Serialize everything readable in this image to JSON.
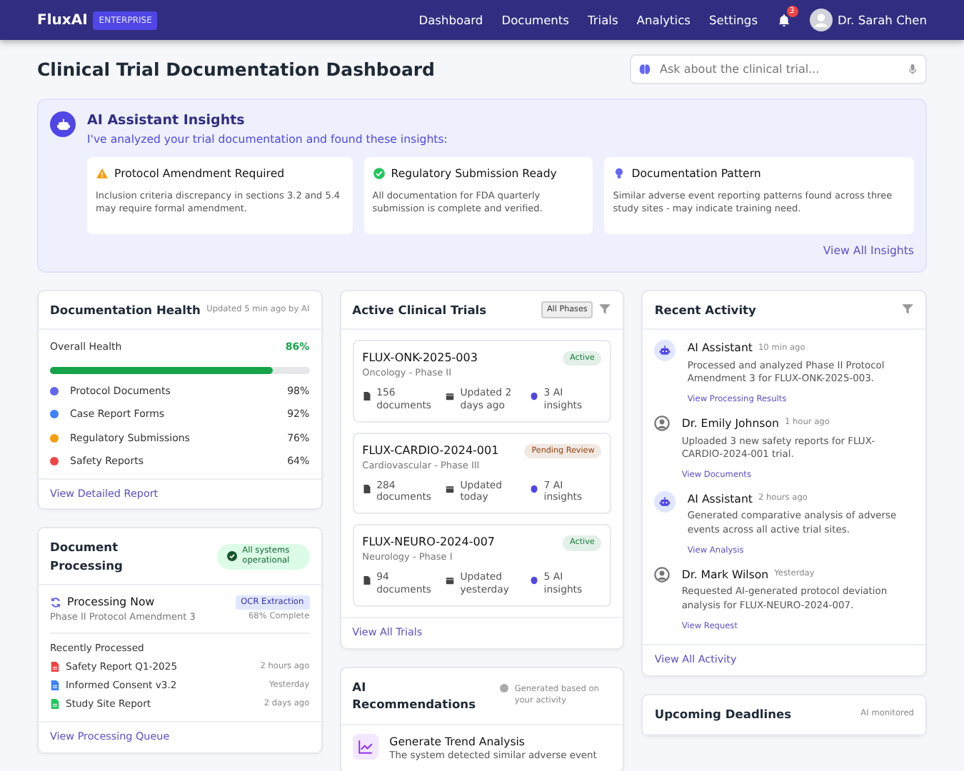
{
  "navbar": {
    "brand": "FluxAI",
    "edition": "ENTERPRISE",
    "links": [
      "Dashboard",
      "Documents",
      "Trials",
      "Analytics",
      "Settings"
    ],
    "notifications": "3",
    "user": "Dr. Sarah Chen"
  },
  "page_title": "Clinical Trial Documentation Dashboard",
  "search": {
    "placeholder": "Ask about the clinical trial..."
  },
  "insights": {
    "title": "AI Assistant Insights",
    "subtitle": "I've analyzed your trial documentation and found these insights:",
    "cards": [
      {
        "kind": "warning",
        "title": "Protocol Amendment Required",
        "text": "Inclusion criteria discrepancy in sections 3.2 and 5.4 may require formal amendment."
      },
      {
        "kind": "success",
        "title": "Regulatory Submission Ready",
        "text": "All documentation for FDA quarterly submission is complete and verified."
      },
      {
        "kind": "idea",
        "title": "Documentation Pattern",
        "text": "Similar adverse event reporting patterns found across three study sites - may indicate training need."
      }
    ],
    "link": "View All Insights"
  },
  "health": {
    "title": "Documentation Health",
    "updated": "Updated 5 min ago by AI",
    "overall_label": "Overall Health",
    "overall_value": "86%",
    "level": 0.86,
    "items": [
      {
        "label": "Protocol Documents",
        "value": "98%",
        "color": "#6366f1"
      },
      {
        "label": "Case Report Forms",
        "value": "92%",
        "color": "#3b82f6"
      },
      {
        "label": "Regulatory Submissions",
        "value": "76%",
        "color": "#f59e0b"
      },
      {
        "label": "Safety Reports",
        "value": "64%",
        "color": "#ef4444"
      }
    ],
    "link": "View Detailed Report"
  },
  "processing": {
    "title": "Document Processing",
    "status": "All systems operational",
    "now_title": "Processing Now",
    "now_document": "Phase II Protocol Amendment 3",
    "now_tag": "OCR Extraction",
    "now_progress": "68% Complete",
    "recent_label": "Recently Processed",
    "items": [
      {
        "kind": "pdf",
        "name": "Safety Report Q1-2025",
        "time": "2 hours ago"
      },
      {
        "kind": "doc",
        "name": "Informed Consent v3.2",
        "time": "Yesterday"
      },
      {
        "kind": "sheet",
        "name": "Study Site Report",
        "time": "2 days ago"
      }
    ],
    "link": "View Processing Queue"
  },
  "trials": {
    "title": "Active Clinical Trials",
    "filter": "All Phases",
    "items": [
      {
        "id": "FLUX-ONK-2025-003",
        "area": "Oncology - Phase II",
        "status": "Active",
        "color": "#15803d",
        "documents": "156 documents",
        "updated": "Updated 2 days ago",
        "insights": "3 AI insights"
      },
      {
        "id": "FLUX-CARDIO-2024-001",
        "area": "Cardiovascular - Phase III",
        "status": "Pending Review",
        "color": "#92400e",
        "documents": "284 documents",
        "updated": "Updated today",
        "insights": "7 AI insights"
      },
      {
        "id": "FLUX-NEURO-2024-007",
        "area": "Neurology - Phase I",
        "status": "Active",
        "color": "#15803d",
        "documents": "94 documents",
        "updated": "Updated yesterday",
        "insights": "5 AI insights"
      }
    ],
    "link": "View All Trials"
  },
  "recommendations": {
    "title": "AI Recommendations",
    "note": "Generated based on your activity",
    "items": [
      {
        "title": "Generate Trend Analysis",
        "text": "The system detected similar adverse event"
      }
    ]
  },
  "activity": {
    "title": "Recent Activity",
    "items": [
      {
        "kind": "ai",
        "name": "AI Assistant",
        "time": "10 min ago",
        "text": "Processed and analyzed Phase II Protocol Amendment 3 for FLUX-ONK-2025-003.",
        "link": "View Processing Results"
      },
      {
        "kind": "user",
        "name": "Dr. Emily Johnson",
        "time": "1 hour ago",
        "text": "Uploaded 3 new safety reports for FLUX-CARDIO-2024-001 trial.",
        "link": "View Documents"
      },
      {
        "kind": "ai",
        "name": "AI Assistant",
        "time": "2 hours ago",
        "text": "Generated comparative analysis of adverse events across all active trial sites.",
        "link": "View Analysis"
      },
      {
        "kind": "user",
        "name": "Dr. Mark Wilson",
        "time": "Yesterday",
        "text": "Requested AI-generated protocol deviation analysis for FLUX-NEURO-2024-007.",
        "link": "View Request"
      }
    ],
    "link": "View All Activity"
  },
  "deadlines": {
    "title": "Upcoming Deadlines",
    "note": "AI monitored"
  }
}
